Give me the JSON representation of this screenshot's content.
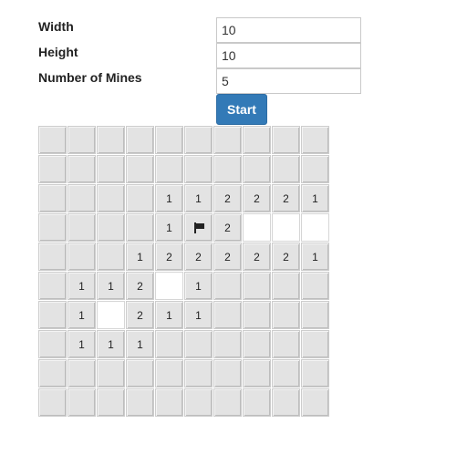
{
  "settings": {
    "width_label": "Width",
    "width_value": "10",
    "height_label": "Height",
    "height_value": "10",
    "mines_label": "Number of Mines",
    "mines_value": "5",
    "start_label": "Start"
  },
  "board": {
    "rows": [
      [
        "",
        "",
        "",
        "",
        "",
        "",
        "",
        "",
        "",
        ""
      ],
      [
        "",
        "",
        "",
        "",
        "",
        "",
        "",
        "",
        "",
        ""
      ],
      [
        "",
        "",
        "",
        "",
        "1",
        "1",
        "2",
        "2",
        "2",
        "1"
      ],
      [
        "",
        "",
        "",
        "",
        "1",
        "F",
        "2",
        "O",
        "O",
        "O"
      ],
      [
        "",
        "",
        "",
        "1",
        "2",
        "2",
        "2",
        "2",
        "2",
        "1"
      ],
      [
        "",
        "1",
        "1",
        "2",
        "O",
        "1",
        "",
        "",
        "",
        ""
      ],
      [
        "",
        "1",
        "O",
        "2",
        "1",
        "1",
        "",
        "",
        "",
        ""
      ],
      [
        "",
        "1",
        "1",
        "1",
        "",
        "",
        "",
        "",
        "",
        ""
      ],
      [
        "",
        "",
        "",
        "",
        "",
        "",
        "",
        "",
        "",
        ""
      ],
      [
        "",
        "",
        "",
        "",
        "",
        "",
        "",
        "",
        "",
        ""
      ]
    ],
    "legend": {
      "": "hidden",
      "F": "hidden-flagged",
      "O": "open-empty",
      "digit": "hidden-with-count"
    },
    "flag_icon": "flag-icon"
  }
}
